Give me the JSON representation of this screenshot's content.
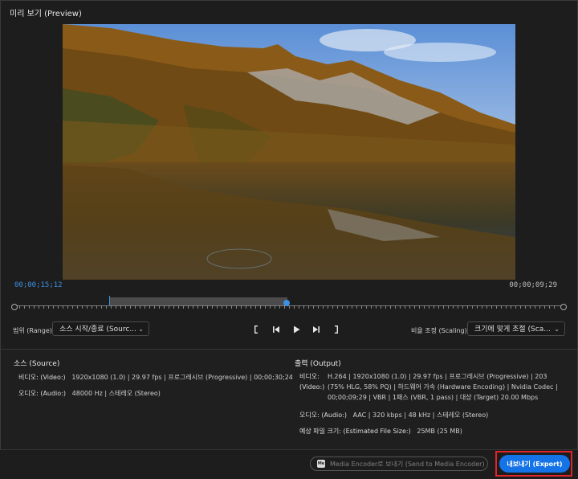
{
  "preview": {
    "title": "미리 보기 (Preview)",
    "current_timecode": "00;00;15;12",
    "duration_timecode": "00;00;09;29",
    "scrub_position": 0.5
  },
  "controls": {
    "range_label": "범위 (Range)",
    "range_value": "소스 시작/종료 (Sourc...",
    "scaling_label": "비율 조정 (Scaling)",
    "scaling_value": "크기에 맞게 조절 (Sca...",
    "transport": [
      "mark-in-icon",
      "step-back-icon",
      "play-icon",
      "step-forward-icon",
      "mark-out-icon"
    ]
  },
  "source": {
    "title": "소스 (Source)",
    "video_label": "비디오: (Video:)",
    "video_value": "1920x1080 (1.0) | 29.97 fps | 프로그레시브 (Progressive) | 00;00;30;24",
    "audio_label": "오디오: (Audio:)",
    "audio_value": "48000 Hz | 스테레오 (Stereo)"
  },
  "output": {
    "title": "출력 (Output)",
    "video_label": "비디오: (Video:)",
    "video_value": "H.264 | 1920x1080 (1.0) | 29.97 fps | 프로그레시브 (Progressive) | 203 (75% HLG, 58% PQ) | 하드웨어 가속 (Hardware Encoding) | Nvidia Codec | 00;00;09;29 | VBR | 1패스 (VBR, 1 pass) | 대상 (Target) 20.00 Mbps",
    "audio_label": "오디오: (Audio:)",
    "audio_value": "AAC | 320 kbps | 48 kHz | 스테레오 (Stereo)",
    "filesize_label": "예상 파일 크기: (Estimated File Size:)",
    "filesize_value": "25MB (25 MB)"
  },
  "footer": {
    "send_label": "Media Encoder로 보내기 (Send to Media Encoder)",
    "export_label": "내보내기 (Export)"
  },
  "colors": {
    "accent": "#1473e6",
    "timecode": "#3d8fe0",
    "highlight": "#e0242a"
  }
}
